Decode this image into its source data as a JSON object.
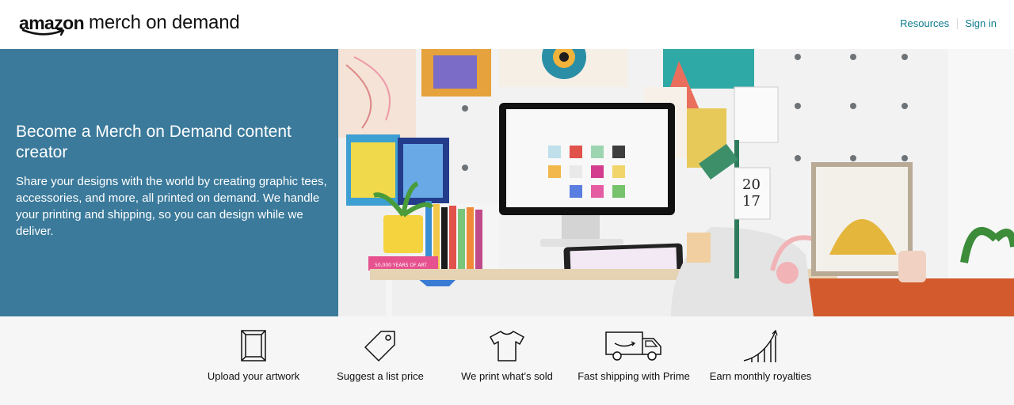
{
  "header": {
    "logo": {
      "brand": "amazon",
      "product": "merch on demand"
    },
    "nav": {
      "resources_label": "Resources",
      "signin_label": "Sign in"
    }
  },
  "hero": {
    "title": "Become a Merch on Demand content creator",
    "description": "Share your designs with the world by creating graphic tees, accessories, and more, all printed on demand. We handle your printing and shipping, so you can design while we deliver.",
    "panel_color": "#3b7a9b",
    "photo": {
      "calendar_top": "20",
      "calendar_bottom": "17",
      "book_spine": "50,000 YEARS OF ART"
    }
  },
  "features": [
    {
      "icon": "frame-icon",
      "label": "Upload your artwork"
    },
    {
      "icon": "price-tag-icon",
      "label": "Suggest a list price"
    },
    {
      "icon": "t-shirt-icon",
      "label": "We print what’s sold"
    },
    {
      "icon": "delivery-truck-icon",
      "label": "Fast shipping with Prime"
    },
    {
      "icon": "growth-chart-icon",
      "label": "Earn monthly royalties"
    }
  ],
  "colors": {
    "link": "#0f7b8f",
    "feature_bg": "#f6f6f6"
  }
}
